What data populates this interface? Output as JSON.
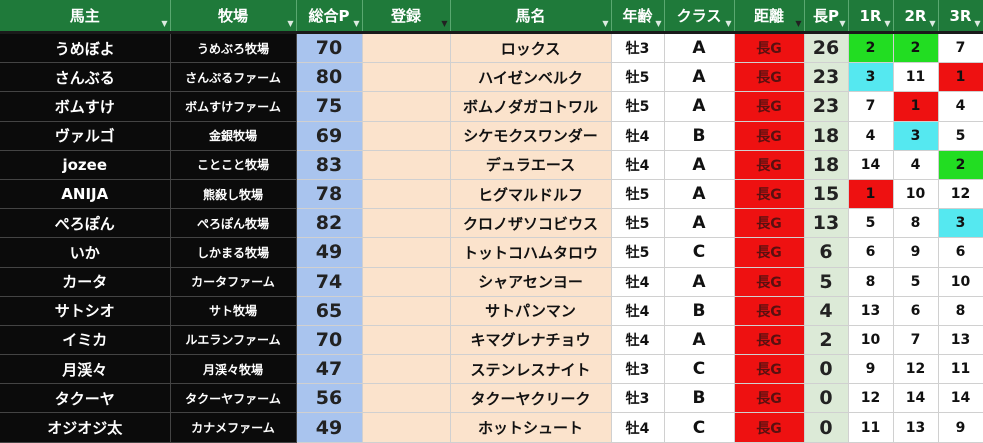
{
  "headers": {
    "owner": "馬主",
    "farm": "牧場",
    "total_points": "総合P",
    "registration": "登録",
    "horse_name": "馬名",
    "age": "年齢",
    "class": "クラス",
    "distance": "距離",
    "long_points": "長P",
    "race1": "1R",
    "race2": "2R",
    "race3": "3R"
  },
  "filter_icon": "filter-dropdown-icon",
  "colors": {
    "header_bg": "#1f7a3a",
    "owner_bg": "#0b0b0b",
    "points_bg": "#a9c4ee",
    "name_bg": "#fbe3cc",
    "distance_bg": "#ee1111",
    "long_points_bg": "#dcead7",
    "rank1": "#ee1111",
    "rank2": "#22dd22",
    "rank3": "#55e8f0"
  },
  "rows": [
    {
      "owner": "うめぼよ",
      "farm": "うめぶろ牧場",
      "pts": "70",
      "reg": "",
      "horse": "ロックス",
      "age": "牡3",
      "cls": "A",
      "dist": "長G",
      "lp": "26",
      "r1": "2",
      "r2": "2",
      "r3": "7"
    },
    {
      "owner": "さんぶる",
      "farm": "さんぷるファーム",
      "pts": "80",
      "reg": "",
      "horse": "ハイゼンベルク",
      "age": "牡5",
      "cls": "A",
      "dist": "長G",
      "lp": "23",
      "r1": "3",
      "r2": "11",
      "r3": "1"
    },
    {
      "owner": "ボムすけ",
      "farm": "ボムすけファーム",
      "pts": "75",
      "reg": "",
      "horse": "ボムノダガコトワル",
      "age": "牡5",
      "cls": "A",
      "dist": "長G",
      "lp": "23",
      "r1": "7",
      "r2": "1",
      "r3": "4"
    },
    {
      "owner": "ヴァルゴ",
      "farm": "金銀牧場",
      "pts": "69",
      "reg": "",
      "horse": "シケモクスワンダー",
      "age": "牡4",
      "cls": "B",
      "dist": "長G",
      "lp": "18",
      "r1": "4",
      "r2": "3",
      "r3": "5"
    },
    {
      "owner": "jozee",
      "farm": "ことこと牧場",
      "pts": "83",
      "reg": "",
      "horse": "デュラエース",
      "age": "牡4",
      "cls": "A",
      "dist": "長G",
      "lp": "18",
      "r1": "14",
      "r2": "4",
      "r3": "2"
    },
    {
      "owner": "ANIJA",
      "farm": "熊殺し牧場",
      "pts": "78",
      "reg": "",
      "horse": "ヒグマルドルフ",
      "age": "牡5",
      "cls": "A",
      "dist": "長G",
      "lp": "15",
      "r1": "1",
      "r2": "10",
      "r3": "12"
    },
    {
      "owner": "ぺろぽん",
      "farm": "ぺろぽん牧場",
      "pts": "82",
      "reg": "",
      "horse": "クロノザソコビウス",
      "age": "牡5",
      "cls": "A",
      "dist": "長G",
      "lp": "13",
      "r1": "5",
      "r2": "8",
      "r3": "3"
    },
    {
      "owner": "いか",
      "farm": "しかまる牧場",
      "pts": "49",
      "reg": "",
      "horse": "トットコハムタロウ",
      "age": "牡5",
      "cls": "C",
      "dist": "長G",
      "lp": "6",
      "r1": "6",
      "r2": "9",
      "r3": "6"
    },
    {
      "owner": "カータ",
      "farm": "カータファーム",
      "pts": "74",
      "reg": "",
      "horse": "シャアセンヨー",
      "age": "牡4",
      "cls": "A",
      "dist": "長G",
      "lp": "5",
      "r1": "8",
      "r2": "5",
      "r3": "10"
    },
    {
      "owner": "サトシオ",
      "farm": "サト牧場",
      "pts": "65",
      "reg": "",
      "horse": "サトパンマン",
      "age": "牡4",
      "cls": "B",
      "dist": "長G",
      "lp": "4",
      "r1": "13",
      "r2": "6",
      "r3": "8"
    },
    {
      "owner": "イミカ",
      "farm": "ルエランファーム",
      "pts": "70",
      "reg": "",
      "horse": "キマグレナチョウ",
      "age": "牡4",
      "cls": "A",
      "dist": "長G",
      "lp": "2",
      "r1": "10",
      "r2": "7",
      "r3": "13"
    },
    {
      "owner": "月渓々",
      "farm": "月渓々牧場",
      "pts": "47",
      "reg": "",
      "horse": "ステンレスナイト",
      "age": "牡3",
      "cls": "C",
      "dist": "長G",
      "lp": "0",
      "r1": "9",
      "r2": "12",
      "r3": "11"
    },
    {
      "owner": "タクーヤ",
      "farm": "タクーヤファーム",
      "pts": "56",
      "reg": "",
      "horse": "タクーヤクリーク",
      "age": "牡3",
      "cls": "B",
      "dist": "長G",
      "lp": "0",
      "r1": "12",
      "r2": "14",
      "r3": "14"
    },
    {
      "owner": "オジオジ太",
      "farm": "カナメファーム",
      "pts": "49",
      "reg": "",
      "horse": "ホットシュート",
      "age": "牡4",
      "cls": "C",
      "dist": "長G",
      "lp": "0",
      "r1": "11",
      "r2": "13",
      "r3": "9"
    }
  ]
}
